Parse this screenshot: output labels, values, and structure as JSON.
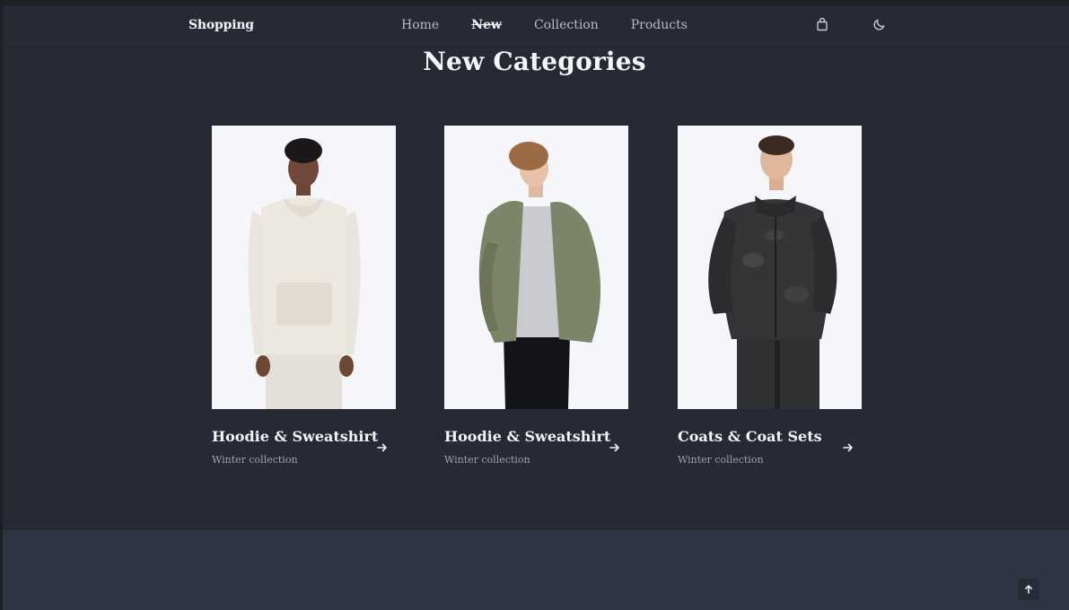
{
  "header": {
    "logo": "Shopping",
    "nav": [
      "Home",
      "New",
      "Collection",
      "Products"
    ],
    "active_nav": "New",
    "icons": [
      "shopping-bag-icon",
      "moon-icon"
    ]
  },
  "section": {
    "title": "New Categories"
  },
  "cards": [
    {
      "name": "Hoodie & Sweatshirt",
      "subtitle": "Winter collection"
    },
    {
      "name": "Hoodie & Sweatshirt",
      "subtitle": "Winter collection"
    },
    {
      "name": "Coats & Coat Sets",
      "subtitle": "Winter collection"
    }
  ],
  "colors": {
    "background": "#262a35",
    "footer_band": "#2e3442",
    "card_photo_bg": "#f4f6f9",
    "text_primary": "#f3f4f7",
    "text_muted": "#9ca2b0"
  },
  "scroll_top": {
    "icon": "arrow-up-icon"
  }
}
